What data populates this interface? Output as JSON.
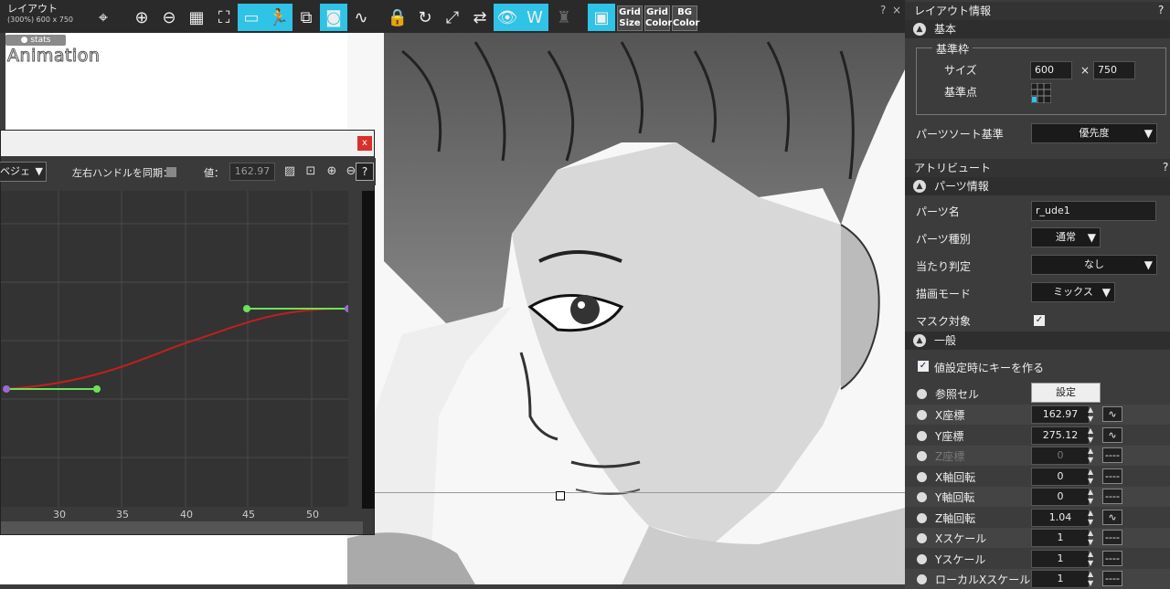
{
  "toolbar": {
    "title": "レイアウト",
    "subtitle": "(300%) 600 x 750",
    "help": "?",
    "close": "×",
    "grid_size": [
      "Grid",
      "Size"
    ],
    "grid_color": [
      "Grid",
      "Color"
    ],
    "bg_color": [
      "BG",
      "Color"
    ]
  },
  "canvas": {
    "stats_tag": "● stats",
    "animation_label": "Animation"
  },
  "graph_editor": {
    "close": "x",
    "interp_value": "ベジェ",
    "sync_label": "左右ハンドルを同期：",
    "value_label": "値：",
    "value": "162.97",
    "help": "?",
    "x_ticks": [
      "30",
      "35",
      "40",
      "45",
      "50"
    ]
  },
  "layout_info": {
    "title": "レイアウト情報",
    "help": "?",
    "section_basic": "基本",
    "group_frame": "基準枠",
    "size_label": "サイズ",
    "width": "600",
    "times": "×",
    "height": "750",
    "anchor_label": "基準点",
    "sort_label": "パーツソート基準",
    "sort_value": "優先度"
  },
  "attributes": {
    "title": "アトリビュート",
    "help": "?",
    "section_parts": "パーツ情報",
    "part_name_label": "パーツ名",
    "part_name": "r_ude1",
    "part_type_label": "パーツ種別",
    "part_type": "通常",
    "hit_label": "当たり判定",
    "hit_value": "なし",
    "blend_label": "描画モード",
    "blend_value": "ミックス",
    "mask_label": "マスク対象",
    "section_general": "一般",
    "key_on_set_label": "値設定時にキーを作る",
    "ref_cell_label": "参照セル",
    "ref_cell_button": "設定",
    "rows": [
      {
        "name": "X座標",
        "value": "162.97",
        "curve": "∿",
        "disabled": false
      },
      {
        "name": "Y座標",
        "value": "275.12",
        "curve": "∿",
        "disabled": false
      },
      {
        "name": "Z座標",
        "value": "0",
        "curve": "----",
        "disabled": true
      },
      {
        "name": "X軸回転",
        "value": "0",
        "curve": "----",
        "disabled": false
      },
      {
        "name": "Y軸回転",
        "value": "0",
        "curve": "----",
        "disabled": false
      },
      {
        "name": "Z軸回転",
        "value": "1.04",
        "curve": "∿",
        "disabled": false
      },
      {
        "name": "Xスケール",
        "value": "1",
        "curve": "----",
        "disabled": false
      },
      {
        "name": "Yスケール",
        "value": "1",
        "curve": "----",
        "disabled": false
      },
      {
        "name": "ローカルXスケール",
        "value": "1",
        "curve": "----",
        "disabled": false
      }
    ]
  },
  "colors": {
    "accent": "#2fc3e6",
    "curve": "#c41e1e",
    "handle": "#6fe05a",
    "key": "#9a6bd0"
  }
}
